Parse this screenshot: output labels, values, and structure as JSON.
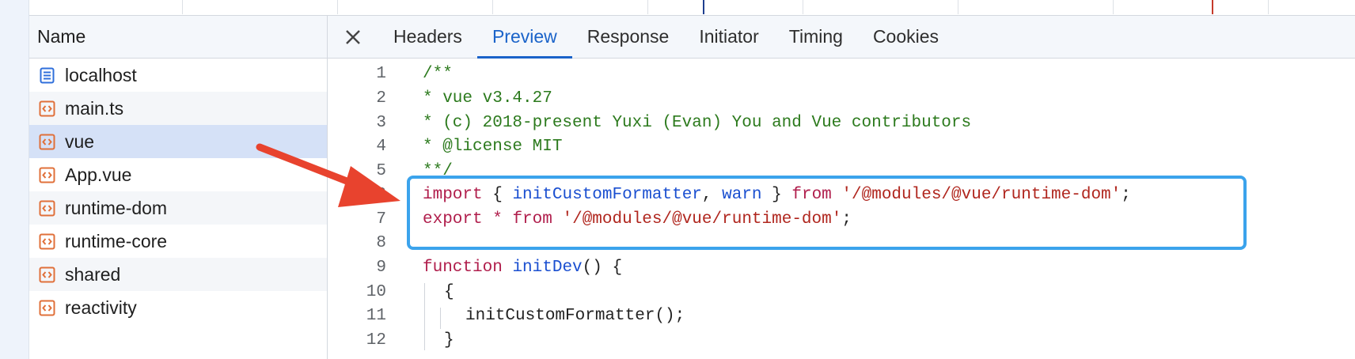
{
  "requests": {
    "header": "Name",
    "items": [
      {
        "label": "localhost",
        "icon": "document-icon"
      },
      {
        "label": "main.ts",
        "icon": "script-icon"
      },
      {
        "label": "vue",
        "icon": "script-icon"
      },
      {
        "label": "App.vue",
        "icon": "script-icon"
      },
      {
        "label": "runtime-dom",
        "icon": "script-icon"
      },
      {
        "label": "runtime-core",
        "icon": "script-icon"
      },
      {
        "label": "shared",
        "icon": "script-icon"
      },
      {
        "label": "reactivity",
        "icon": "script-icon"
      }
    ],
    "selected_index": 2
  },
  "tabs": {
    "items": [
      "Headers",
      "Preview",
      "Response",
      "Initiator",
      "Timing",
      "Cookies"
    ],
    "active": "Preview"
  },
  "code": {
    "lines": [
      {
        "n": "1",
        "t": "/**"
      },
      {
        "n": "2",
        "t": "* vue v3.4.27"
      },
      {
        "n": "3",
        "t": "* (c) 2018-present Yuxi (Evan) You and Vue contributors"
      },
      {
        "n": "4",
        "t": "* @license MIT"
      },
      {
        "n": "5",
        "t": "**/"
      },
      {
        "n": "6",
        "t": "import { initCustomFormatter, warn } from '/@modules/@vue/runtime-dom';"
      },
      {
        "n": "7",
        "t": "export * from '/@modules/@vue/runtime-dom';"
      },
      {
        "n": "8",
        "t": ""
      },
      {
        "n": "9",
        "t": "function initDev() {"
      },
      {
        "n": "10",
        "t": "{"
      },
      {
        "n": "11",
        "t": "initCustomFormatter();"
      },
      {
        "n": "12",
        "t": "}"
      }
    ],
    "tokens": {
      "import": "import",
      "lbrace": "{",
      "initCustomFormatter": "initCustomFormatter",
      "comma": ",",
      "warn": "warn",
      "rbrace": "}",
      "from": "from",
      "path": "'/@modules/@vue/runtime-dom'",
      "semi": ";",
      "export": "export",
      "star": "*",
      "function": "function",
      "initDev": "initDev",
      "parens_brace": "() {",
      "call": "initCustomFormatter();"
    }
  },
  "colors": {
    "accent": "#1a63c9",
    "selected_row": "#d5e1f7",
    "comment": "#2c7a1d",
    "keyword": "#b01e4c",
    "string": "#b0261e",
    "identifier": "#1a4fd0",
    "highlight_box": "#3ba3ec",
    "annotation_arrow": "#e8432e"
  }
}
